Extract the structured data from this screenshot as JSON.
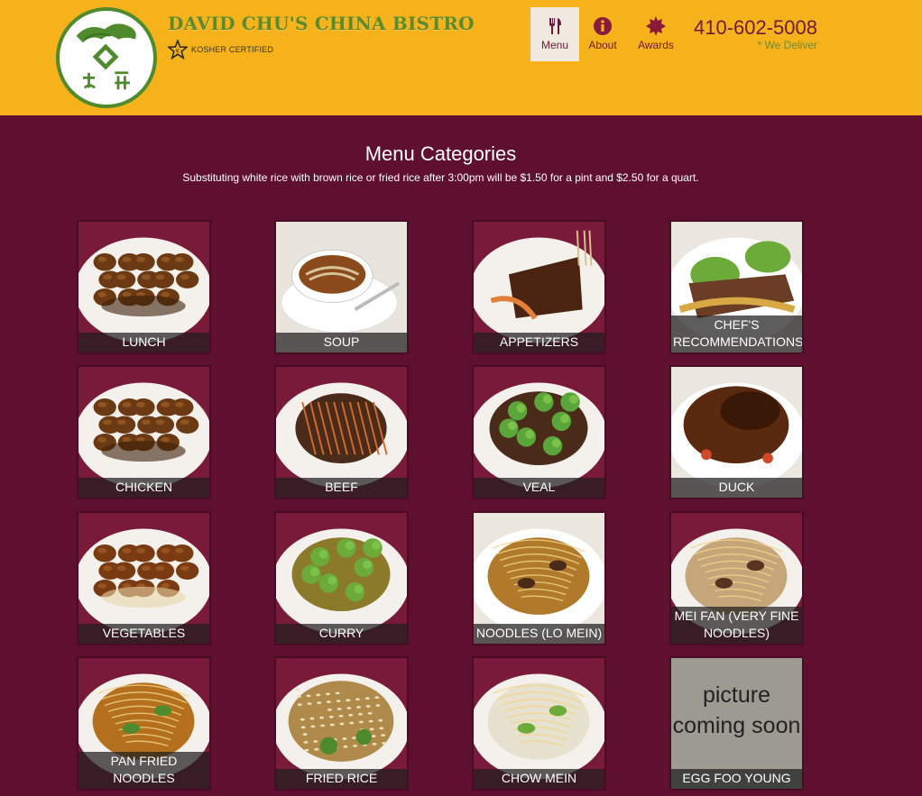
{
  "brand": {
    "name": "DAVID CHU'S CHINA BISTRO",
    "kosher_label": "KOSHER CERTIFIED",
    "logo_icon": "dragon-logo-icon"
  },
  "nav": [
    {
      "label": "Menu",
      "icon": "utensils-icon",
      "active": true
    },
    {
      "label": "About",
      "icon": "info-icon",
      "active": false
    },
    {
      "label": "Awards",
      "icon": "award-badge-icon",
      "active": false
    }
  ],
  "contact": {
    "phone": "410-602-5008",
    "delivery_note": "* We Deliver"
  },
  "colors": {
    "header_bg": "#f5b21a",
    "page_bg": "#5f1030",
    "accent": "#6c1b3c",
    "green": "#5d8a2a"
  },
  "content": {
    "title": "Menu Categories",
    "subtitle": "Substituting white rice with brown rice or fried rice after 3:00pm will be $1.50 for a pint and $2.50 for a quart."
  },
  "categories": [
    {
      "label": "LUNCH"
    },
    {
      "label": "SOUP"
    },
    {
      "label": "APPETIZERS"
    },
    {
      "label": "CHEF'S RECOMMENDATIONS"
    },
    {
      "label": "CHICKEN"
    },
    {
      "label": "BEEF"
    },
    {
      "label": "VEAL"
    },
    {
      "label": "DUCK"
    },
    {
      "label": "VEGETABLES"
    },
    {
      "label": "CURRY"
    },
    {
      "label": "NOODLES (LO MEIN)"
    },
    {
      "label": "MEI FAN (VERY FINE NOODLES)"
    },
    {
      "label": "PAN FRIED NOODLES"
    },
    {
      "label": "FRIED RICE"
    },
    {
      "label": "CHOW MEIN"
    },
    {
      "label": "EGG FOO YOUNG",
      "placeholder_text": "picture coming soon"
    }
  ]
}
